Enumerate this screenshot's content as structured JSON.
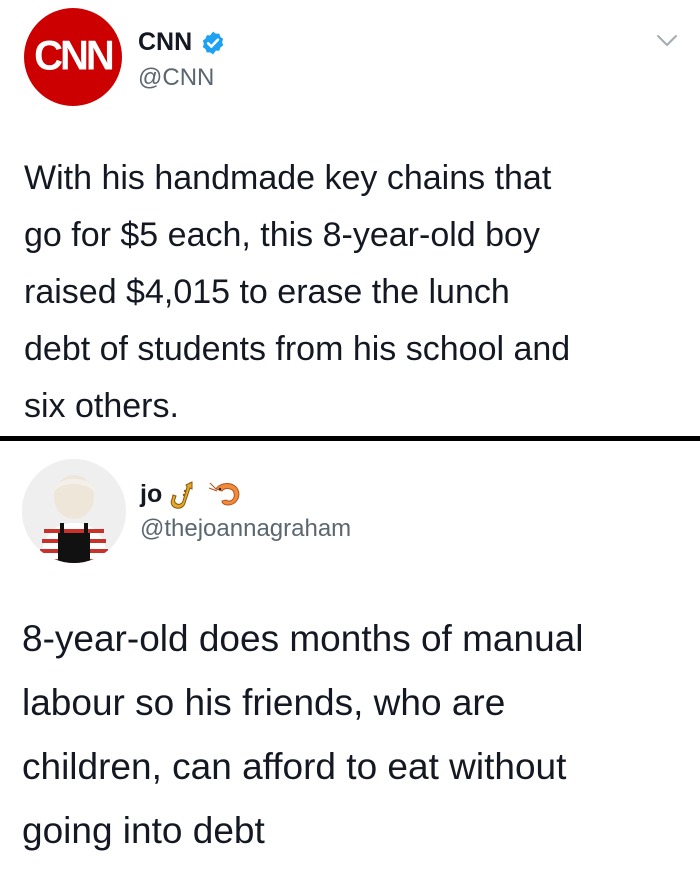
{
  "tweet1": {
    "avatar_text": "CNN",
    "display_name": "CNN",
    "handle": "@CNN",
    "verified_icon": "verified-badge-icon",
    "menu_icon": "chevron-down-icon",
    "text": "With his handmade key chains that\ngo for $5 each, this 8-year-old boy\nraised $4,015 to erase the lunch\ndebt of students from his school and\nsix others."
  },
  "tweet2": {
    "display_name": "jo",
    "emoji_icons": [
      "saxophone-emoji",
      "shrimp-emoji"
    ],
    "handle": "@thejoannagraham",
    "text": "8-year-old does months of manual\nlabour so his friends, who are\nchildren, can afford to eat without\ngoing into debt"
  },
  "colors": {
    "cnn_red": "#cc0000",
    "verified_blue": "#1da1f2",
    "handle_gray": "#5b6770",
    "divider": "#000000"
  }
}
